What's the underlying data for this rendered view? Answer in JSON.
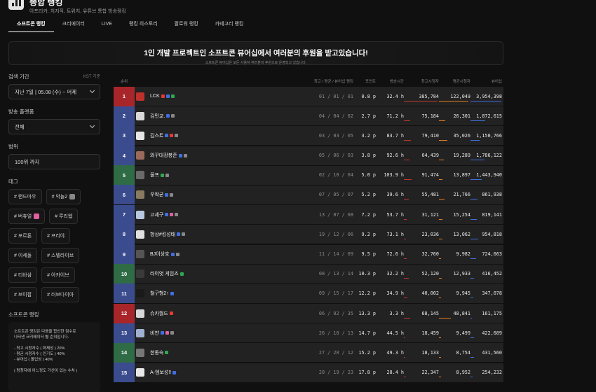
{
  "header": {
    "title": "종합 랭킹",
    "subtitle": "아프리카, 치지직, 트위치, 유튜브 통합 방송랭킹",
    "tabs": [
      "소프트콘 랭킹",
      "크리에이터",
      "LIVE",
      "랭킹 히스토리",
      "팔로워 랭킹",
      "카테고리 랭킹"
    ]
  },
  "banner": {
    "title": "1인 개발 프로젝트인 소프트콘 뷰어십에서 여러분의 후원을 받고있습니다!",
    "subtitle": "소프트콘 뷰어십은 모든 사용자 여러분의 후원으로 운영되고 있습니다."
  },
  "sidebar": {
    "period_label": "검색 기간",
    "timezone": "KST 기준",
    "period_value": "지난 7일 | 05.08 (수) ~ 어제",
    "platform_label": "방송 플랫폼",
    "platform_value": "전체",
    "range_label": "범위",
    "range_value": "100위 까지",
    "tags_label": "태그",
    "tags": [
      {
        "label": "# 랜드마우",
        "icon": false
      },
      {
        "label": "# 악놀2",
        "icon": true,
        "color": "#888"
      },
      {
        "label": "# 버츄얼",
        "icon": true,
        "color": "#e060a0"
      },
      {
        "label": "# 루리웹",
        "icon": false
      },
      {
        "label": "# 포르톤",
        "icon": false
      },
      {
        "label": "# 프리야",
        "icon": false
      },
      {
        "label": "# 이세돌",
        "icon": false
      },
      {
        "label": "# 스텔라이브",
        "icon": false
      },
      {
        "label": "# 티바삼",
        "icon": false
      },
      {
        "label": "# 아카이브",
        "icon": false
      },
      {
        "label": "# 브이팝",
        "icon": false
      },
      {
        "label": "# 러브다이아",
        "icon": false
      }
    ],
    "info_label": "소프트콘 랭킹",
    "info_lines": [
      "소프트콘 랭킹은 다음을 합산한 점수로",
      "나타낸 크리에이터 별 순위입니다.",
      "",
      "- 최고 시청자수 ( 화제성 ) 20%",
      "- 평균 시청자수 ( 인기도 ) 40%",
      "- 뷰어십 ( 몰입성 ) 40%",
      "",
      "( 평청자에 어느정도 가산이 있는 수치 )"
    ]
  },
  "table": {
    "headers": [
      "순위",
      "최고 / 평균 / 뷰어십 랭킹",
      "포인트",
      "방송시간",
      "최고시청자",
      "평균시청자",
      "뷰어십"
    ],
    "rows": [
      {
        "rank": "1",
        "name": "LCK",
        "badges": [
          "#e53935",
          "#3f6fe0",
          "#2fa84f"
        ],
        "ranks": "01 / 01 / 01",
        "points": "0.8 p",
        "hours": "32.4 h",
        "peak": "385,784",
        "avg": "122,049",
        "viewership": "3,954,398",
        "color": "#a8252a",
        "avatar": "#c0302b"
      },
      {
        "rank": "2",
        "name": "김민교.",
        "badges": [
          "#3f6fe0",
          "#888"
        ],
        "ranks": "04 / 04 / 02",
        "points": "2.7 p",
        "hours": "71.2 h",
        "peak": "75,184",
        "avg": "26,301",
        "viewership": "1,872,615",
        "color": "#3a4c8e",
        "avatar": "#d9d9d9"
      },
      {
        "rank": "3",
        "name": "김스트",
        "badges": [
          "#3f6fe0",
          "#e53935",
          "#888"
        ],
        "ranks": "03 / 03 / 05",
        "points": "3.2 p",
        "hours": "83.7 h",
        "peak": "79,410",
        "avg": "35,026",
        "viewership": "1,150,766",
        "color": "#3a4c8e",
        "avatar": "#e6e6e6"
      },
      {
        "rank": "4",
        "name": "와꾸대장봉준",
        "badges": [
          "#3f6fe0",
          "#888"
        ],
        "ranks": "05 / 06 / 03",
        "points": "3.8 p",
        "hours": "92.6 h",
        "peak": "64,439",
        "avg": "19,289",
        "viewership": "1,786,122",
        "color": "#3a4c8e",
        "avatar": "#9a6a5a"
      },
      {
        "rank": "5",
        "name": "울프",
        "badges": [
          "#2fa84f",
          "#888"
        ],
        "ranks": "02 / 10 / 04",
        "points": "5.0 p",
        "hours": "103.9 h",
        "peak": "91,474",
        "avg": "13,897",
        "viewership": "1,443,940",
        "color": "#2f6b45",
        "avatar": "#6a6a6a"
      },
      {
        "rank": "6",
        "name": "우왁굳",
        "badges": [
          "#3f6fe0",
          "#888"
        ],
        "ranks": "07 / 05 / 07",
        "points": "5.2 p",
        "hours": "39.6 h",
        "peak": "55,481",
        "avg": "21,766",
        "viewership": "861,938",
        "color": "#3a4c8e",
        "avatar": "#8a7a60"
      },
      {
        "rank": "7",
        "name": "고세구",
        "badges": [
          "#3f6fe0",
          "#e060a0",
          "#888"
        ],
        "ranks": "13 / 07 / 08",
        "points": "7.2 p",
        "hours": "53.7 h",
        "peak": "31,121",
        "avg": "15,254",
        "viewership": "819,141",
        "color": "#3a4c8e",
        "avatar": "#b8c8e0"
      },
      {
        "rank": "8",
        "name": "항상#킹성태",
        "badges": [
          "#3f6fe0",
          "#888"
        ],
        "ranks": "19 / 12 / 06",
        "points": "9.2 p",
        "hours": "73.1 h",
        "peak": "23,036",
        "avg": "13,062",
        "viewership": "954,818",
        "color": "#3a4c8e",
        "avatar": "#e0e0e0"
      },
      {
        "rank": "9",
        "name": "BJ이상호",
        "badges": [
          "#3f6fe0",
          "#888"
        ],
        "ranks": "11 / 14 / 09",
        "points": "9.5 p",
        "hours": "72.6 h",
        "peak": "32,760",
        "avg": "9,982",
        "viewership": "724,663",
        "color": "#3a4c8e",
        "avatar": "#555"
      },
      {
        "rank": "10",
        "name": "라이엇 게임즈",
        "badges": [
          "#2fa84f"
        ],
        "ranks": "08 / 13 / 14",
        "points": "10.3 p",
        "hours": "32.2 h",
        "peak": "52,120",
        "avg": "12,933",
        "viewership": "416,452",
        "color": "#2f6b45",
        "avatar": "#3a3a3a"
      },
      {
        "rank": "11",
        "name": "철구형2↑",
        "badges": [
          "#3f6fe0"
        ],
        "ranks": "09 / 15 / 17",
        "points": "12.2 p",
        "hours": "34.9 h",
        "peak": "40,002",
        "avg": "9,945",
        "viewership": "347,078",
        "color": "#3a4c8e",
        "avatar": "#1a1a1a"
      },
      {
        "rank": "12",
        "name": "슈카월드",
        "badges": [
          "#e53935"
        ],
        "ranks": "06 / 02 / 35",
        "points": "13.3 p",
        "hours": "3.3 h",
        "peak": "68,145",
        "avg": "48,841",
        "viewership": "161,175",
        "color": "#a8252a",
        "avatar": "#d8d8d8"
      },
      {
        "rank": "13",
        "name": "비챤",
        "badges": [
          "#3f6fe0",
          "#e060a0",
          "#888"
        ],
        "ranks": "26 / 18 / 13",
        "points": "14.7 p",
        "hours": "44.5 h",
        "peak": "18,459",
        "avg": "9,499",
        "viewership": "422,689",
        "color": "#3a4c8e",
        "avatar": "#a0b0d0"
      },
      {
        "rank": "14",
        "name": "한동숙",
        "badges": [
          "#2fa84f"
        ],
        "ranks": "27 / 20 / 12",
        "points": "15.2 p",
        "hours": "49.3 h",
        "peak": "18,133",
        "avg": "8,754",
        "viewership": "431,560",
        "color": "#2f6b45",
        "avatar": "#777"
      },
      {
        "rank": "15",
        "name": "A-엠보성!!",
        "badges": [
          "#3f6fe0"
        ],
        "ranks": "20 / 19 / 23",
        "points": "17.8 p",
        "hours": "28.4 h",
        "peak": "22,347",
        "avg": "8,952",
        "viewership": "254,232",
        "color": "#3a4c8e",
        "avatar": "#e8e8e8"
      }
    ]
  },
  "colors": {
    "bar_red": "#c0392b",
    "bar_orange": "#e67e22",
    "bar_blue": "#3f6fe0"
  }
}
